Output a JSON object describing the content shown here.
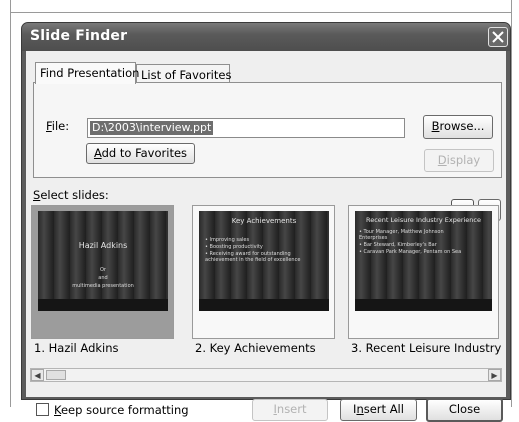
{
  "dialog": {
    "title": "Slide Finder",
    "close_icon": "close-x-icon"
  },
  "tabs": [
    {
      "label": "Find Presentation",
      "active": true
    },
    {
      "label": "List of Favorites",
      "active": false
    }
  ],
  "file": {
    "label_access": "F",
    "label_rest": "ile:",
    "value": "D:\\2003\\interview.ppt"
  },
  "buttons": {
    "add_favorites_access": "A",
    "add_favorites_rest": "dd to Favorites",
    "browse_access": "B",
    "browse_rest": "rowse...",
    "display_access": "D",
    "display_rest": "isplay",
    "insert_access": "I",
    "insert_rest": "nsert",
    "insert_all_pre": "I",
    "insert_all_access": "n",
    "insert_all_rest": "sert All",
    "close": "Close"
  },
  "select_slides": {
    "label_access": "S",
    "label_rest": "elect slides:",
    "view_icons": [
      "thumbnail-view-icon",
      "list-view-icon"
    ]
  },
  "slides": [
    {
      "caption": "1. Hazil Adkins",
      "title": "Hazil Adkins",
      "lines": [
        "Or",
        "and",
        "multimedia presentation"
      ],
      "selected": true
    },
    {
      "caption": "2. Key Achievements",
      "title": "Key Achievements",
      "lines": [
        "• Improving sales",
        "• Boosting productivity",
        "• Receiving award for outstanding",
        "  achievement in the field of excellence"
      ],
      "selected": false
    },
    {
      "caption": "3. Recent Leisure Industry",
      "title": "Recent Leisure Industry Experience",
      "lines": [
        "• Tour Manager, Matthew Johnson",
        "  Enterprises",
        "• Bar Steward, Kimberley's Bar",
        "• Caravan Park Manager, Pentam on Sea"
      ],
      "selected": false
    }
  ],
  "scroll_icons": [
    "scroll-left-icon",
    "scroll-right-icon"
  ],
  "keep_formatting": {
    "label_access": "K",
    "label_rest": "eep source formatting",
    "checked": false
  }
}
